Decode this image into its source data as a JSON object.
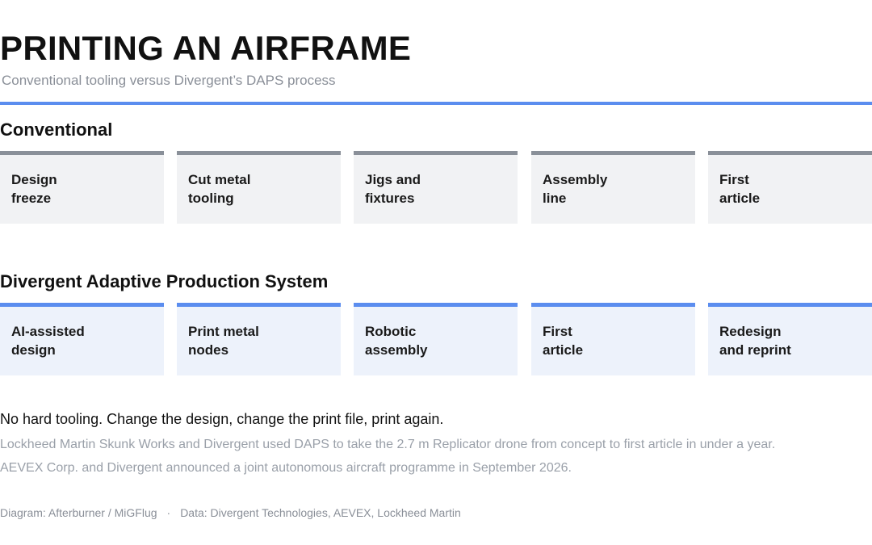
{
  "header": {
    "title": "PRINTING AN AIRFRAME",
    "subtitle": "Conventional tooling versus Divergent’s DAPS process"
  },
  "conventional": {
    "heading": "Conventional",
    "steps": [
      "Design\nfreeze",
      "Cut metal\ntooling",
      "Jigs and\nfixtures",
      "Assembly\nline",
      "First\narticle"
    ]
  },
  "daps": {
    "heading": "Divergent Adaptive Production System",
    "steps": [
      "AI-assisted\ndesign",
      "Print metal\nnodes",
      "Robotic\nassembly",
      "First\narticle",
      "Redesign\nand reprint"
    ]
  },
  "notes": {
    "tagline": "No hard tooling. Change the design, change the print file, print again.",
    "line1": "Lockheed Martin Skunk Works and Divergent used DAPS to take the 2.7 m Replicator drone from concept to first article in under a year.",
    "line2": "AEVEX Corp. and Divergent announced a joint autonomous aircraft programme in September 2026."
  },
  "footer": {
    "credit": "Diagram: Afterburner / MiGFlug",
    "separator": "·",
    "source": "Data: Divergent Technologies, AEVEX, Lockheed Martin"
  },
  "colors": {
    "accent": "#5b8def",
    "conventional_bar": "#8a9099",
    "conventional_fill": "#f1f2f4",
    "daps_fill": "#edf2fb",
    "muted_text": "#9aa0a9"
  }
}
